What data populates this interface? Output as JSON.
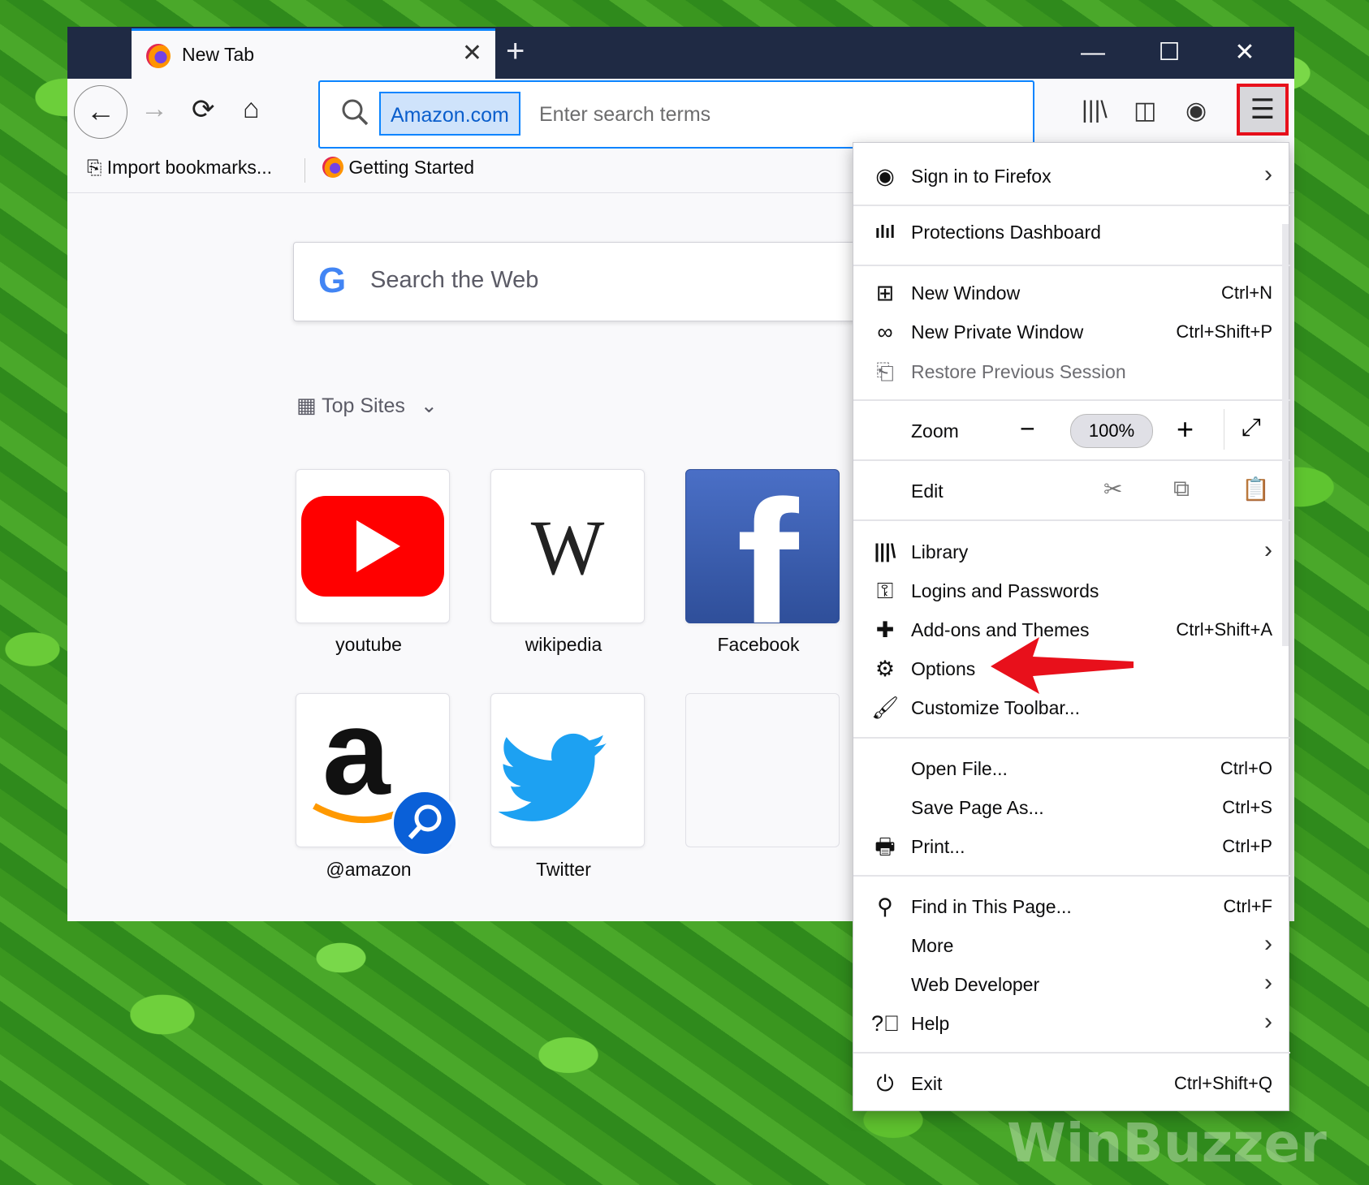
{
  "tab": {
    "title": "New Tab"
  },
  "window_controls": {
    "minimize": "—",
    "maximize": "☐",
    "close": "✕"
  },
  "urlbar": {
    "engine": "Amazon.com",
    "placeholder": "Enter search terms"
  },
  "bookmarks": [
    {
      "label": "Import bookmarks..."
    },
    {
      "label": "Getting Started"
    }
  ],
  "websearch": {
    "placeholder": "Search the Web",
    "logo": "G"
  },
  "topsites": {
    "header": "Top Sites",
    "tiles": [
      {
        "label": "youtube"
      },
      {
        "label": "wikipedia",
        "logo": "W"
      },
      {
        "label": "Facebook",
        "logo": "f"
      },
      {
        "label": "@amazon",
        "logo": "a"
      },
      {
        "label": "Twitter"
      },
      {
        "label": ""
      }
    ]
  },
  "menu": {
    "sign_in": "Sign in to Firefox",
    "protections": "Protections Dashboard",
    "new_window": {
      "label": "New Window",
      "shortcut": "Ctrl+N"
    },
    "new_private": {
      "label": "New Private Window",
      "shortcut": "Ctrl+Shift+P"
    },
    "restore": "Restore Previous Session",
    "zoom": {
      "label": "Zoom",
      "value": "100%"
    },
    "edit": "Edit",
    "library": "Library",
    "logins": "Logins and Passwords",
    "addons": {
      "label": "Add-ons and Themes",
      "shortcut": "Ctrl+Shift+A"
    },
    "options": "Options",
    "customize": "Customize Toolbar...",
    "open_file": {
      "label": "Open File...",
      "shortcut": "Ctrl+O"
    },
    "save_page": {
      "label": "Save Page As...",
      "shortcut": "Ctrl+S"
    },
    "print": {
      "label": "Print...",
      "shortcut": "Ctrl+P"
    },
    "find": {
      "label": "Find in This Page...",
      "shortcut": "Ctrl+F"
    },
    "more": "More",
    "web_dev": "Web Developer",
    "help": "Help",
    "exit": {
      "label": "Exit",
      "shortcut": "Ctrl+Shift+Q"
    }
  },
  "watermark": "WinBuzzer",
  "colors": {
    "accent": "#0a84ff",
    "highlight_box": "#e8101b",
    "arrow": "#e8101b",
    "titlebar": "#1f2a44"
  }
}
